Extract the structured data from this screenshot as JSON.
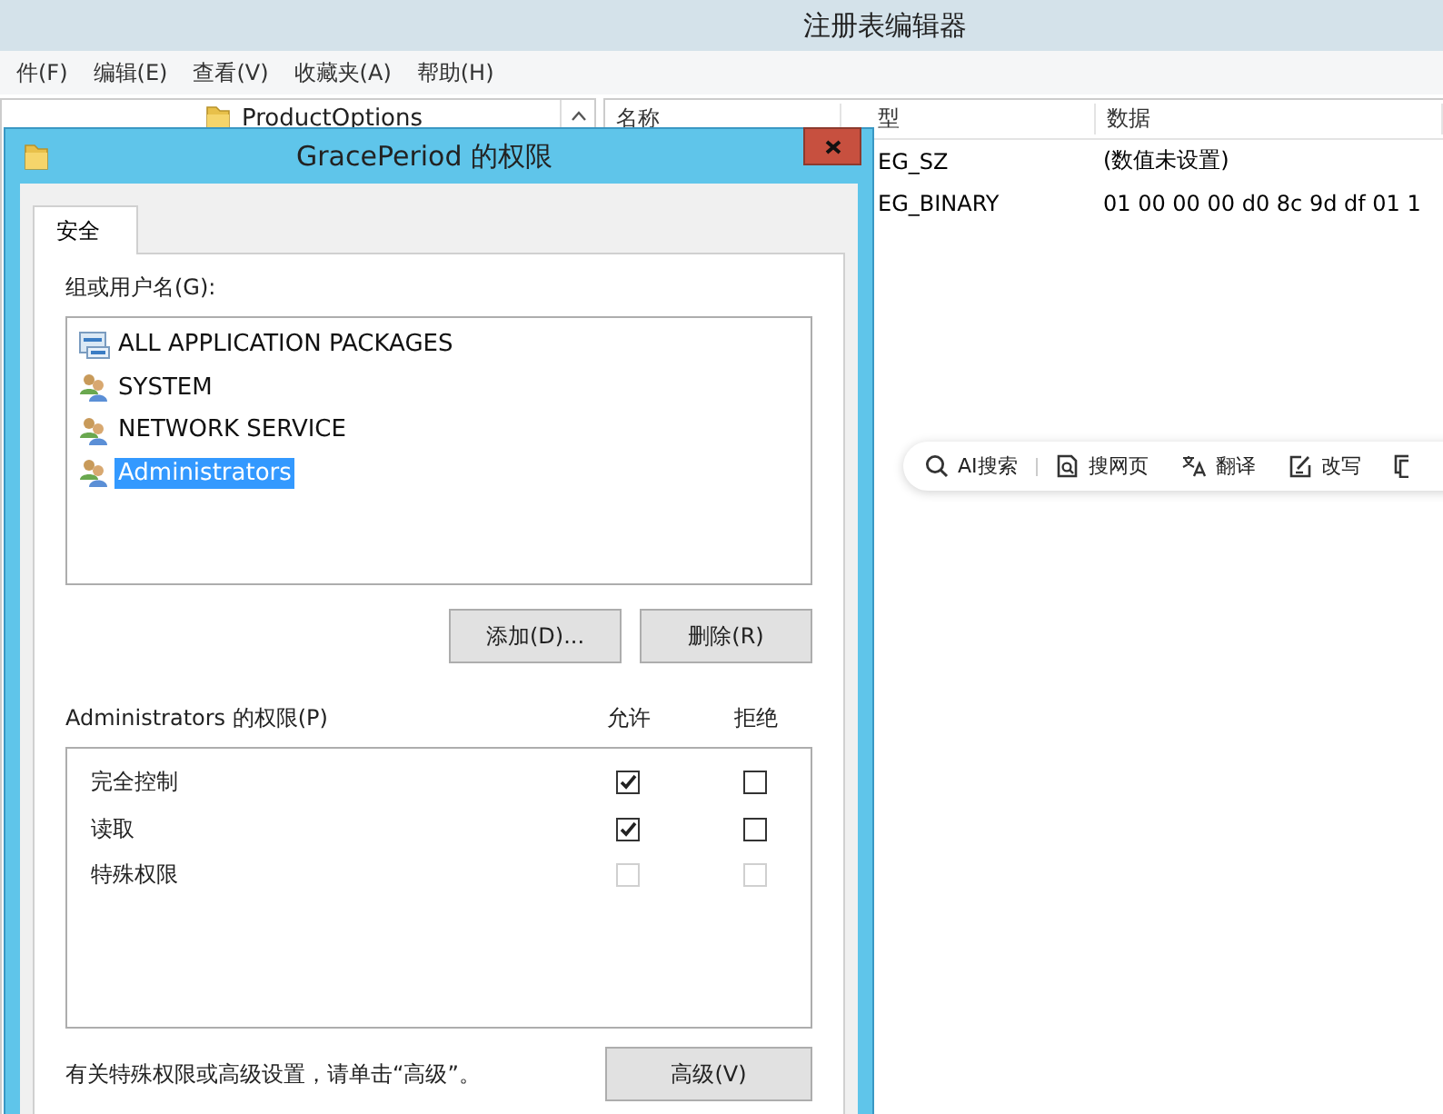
{
  "registry_window": {
    "title": "注册表编辑器",
    "menu": [
      "件(F)",
      "编辑(E)",
      "查看(V)",
      "收藏夹(A)",
      "帮助(H)"
    ],
    "tree_items": [
      {
        "label": "ProductOptions"
      }
    ],
    "columns": [
      "名称",
      "型",
      "数据"
    ],
    "rows": [
      {
        "type": "EG_SZ",
        "data": "(数值未设置)"
      },
      {
        "type": "EG_BINARY",
        "data": "01 00 00 00 d0 8c 9d df 01 1"
      }
    ]
  },
  "dialog": {
    "title": "GracePeriod 的权限",
    "tabs": [
      {
        "label": "安全",
        "selected": true
      }
    ],
    "group_label": "组或用户名(G):",
    "principals": [
      {
        "name": "ALL APPLICATION PACKAGES",
        "kind": "package",
        "selected": false
      },
      {
        "name": "SYSTEM",
        "kind": "group",
        "selected": false
      },
      {
        "name": "NETWORK SERVICE",
        "kind": "group",
        "selected": false
      },
      {
        "name": "Administrators",
        "kind": "group",
        "selected": true
      }
    ],
    "buttons": [
      "添加(D)...",
      "删除(R)"
    ],
    "permissions_label": "Administrators 的权限(P)",
    "allow_header": "允许",
    "deny_header": "拒绝",
    "permissions": [
      {
        "name": "完全控制",
        "allow": {
          "checked": true,
          "disabled": false
        },
        "deny": {
          "checked": false,
          "disabled": false
        }
      },
      {
        "name": "读取",
        "allow": {
          "checked": true,
          "disabled": false
        },
        "deny": {
          "checked": false,
          "disabled": false
        }
      },
      {
        "name": "特殊权限",
        "allow": {
          "checked": false,
          "disabled": true
        },
        "deny": {
          "checked": false,
          "disabled": true
        }
      }
    ],
    "note": "有关特殊权限或高级设置，请单击“高级”。",
    "advanced_button": "高级(V)"
  },
  "floating_toolbar": {
    "items": [
      {
        "label": "AI搜索",
        "kind": "search"
      },
      {
        "label": "搜网页",
        "kind": "web"
      },
      {
        "label": "翻译",
        "kind": "translate"
      },
      {
        "label": "改写",
        "kind": "rewrite"
      },
      {
        "kind": "copy"
      }
    ]
  }
}
